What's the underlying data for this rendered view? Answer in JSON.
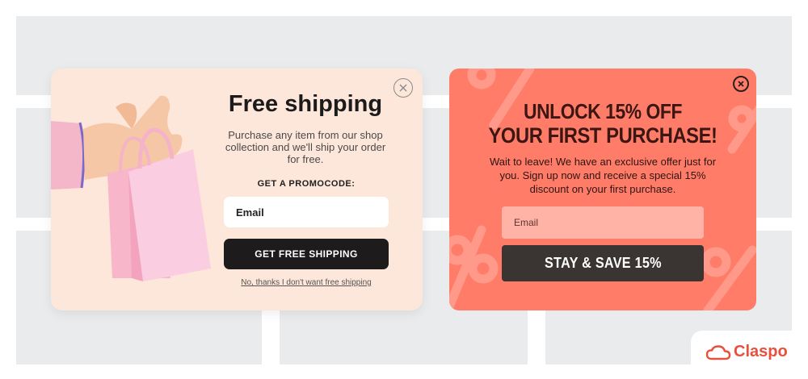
{
  "popup_shipping": {
    "title": "Free shipping",
    "description": "Purchase any item from our shop collection and we'll ship your order for free.",
    "promo_label": "GET A PROMOCODE:",
    "email_placeholder": "Email",
    "button_label": "GET FREE SHIPPING",
    "decline_label": "No, thanks I don't want free shipping",
    "close_icon": "close-icon"
  },
  "popup_discount": {
    "title_line1": "UNLOCK 15% OFF",
    "title_line2": "YOUR FIRST PURCHASE!",
    "body": "Wait to leave! We have an exclusive offer just for you. Sign up now and receive a special 15% discount on your first purchase.",
    "email_placeholder": "Email",
    "button_label": "STAY & SAVE 15%",
    "close_icon": "close-icon"
  },
  "logo": {
    "name": "Claspo",
    "icon": "cloud-icon"
  },
  "colors": {
    "page_bg": "#eaebed",
    "shipping_bg": "#fde6da",
    "discount_bg": "#ff7c68",
    "dark_button": "#1d1b1b",
    "brand": "#e8503e"
  }
}
